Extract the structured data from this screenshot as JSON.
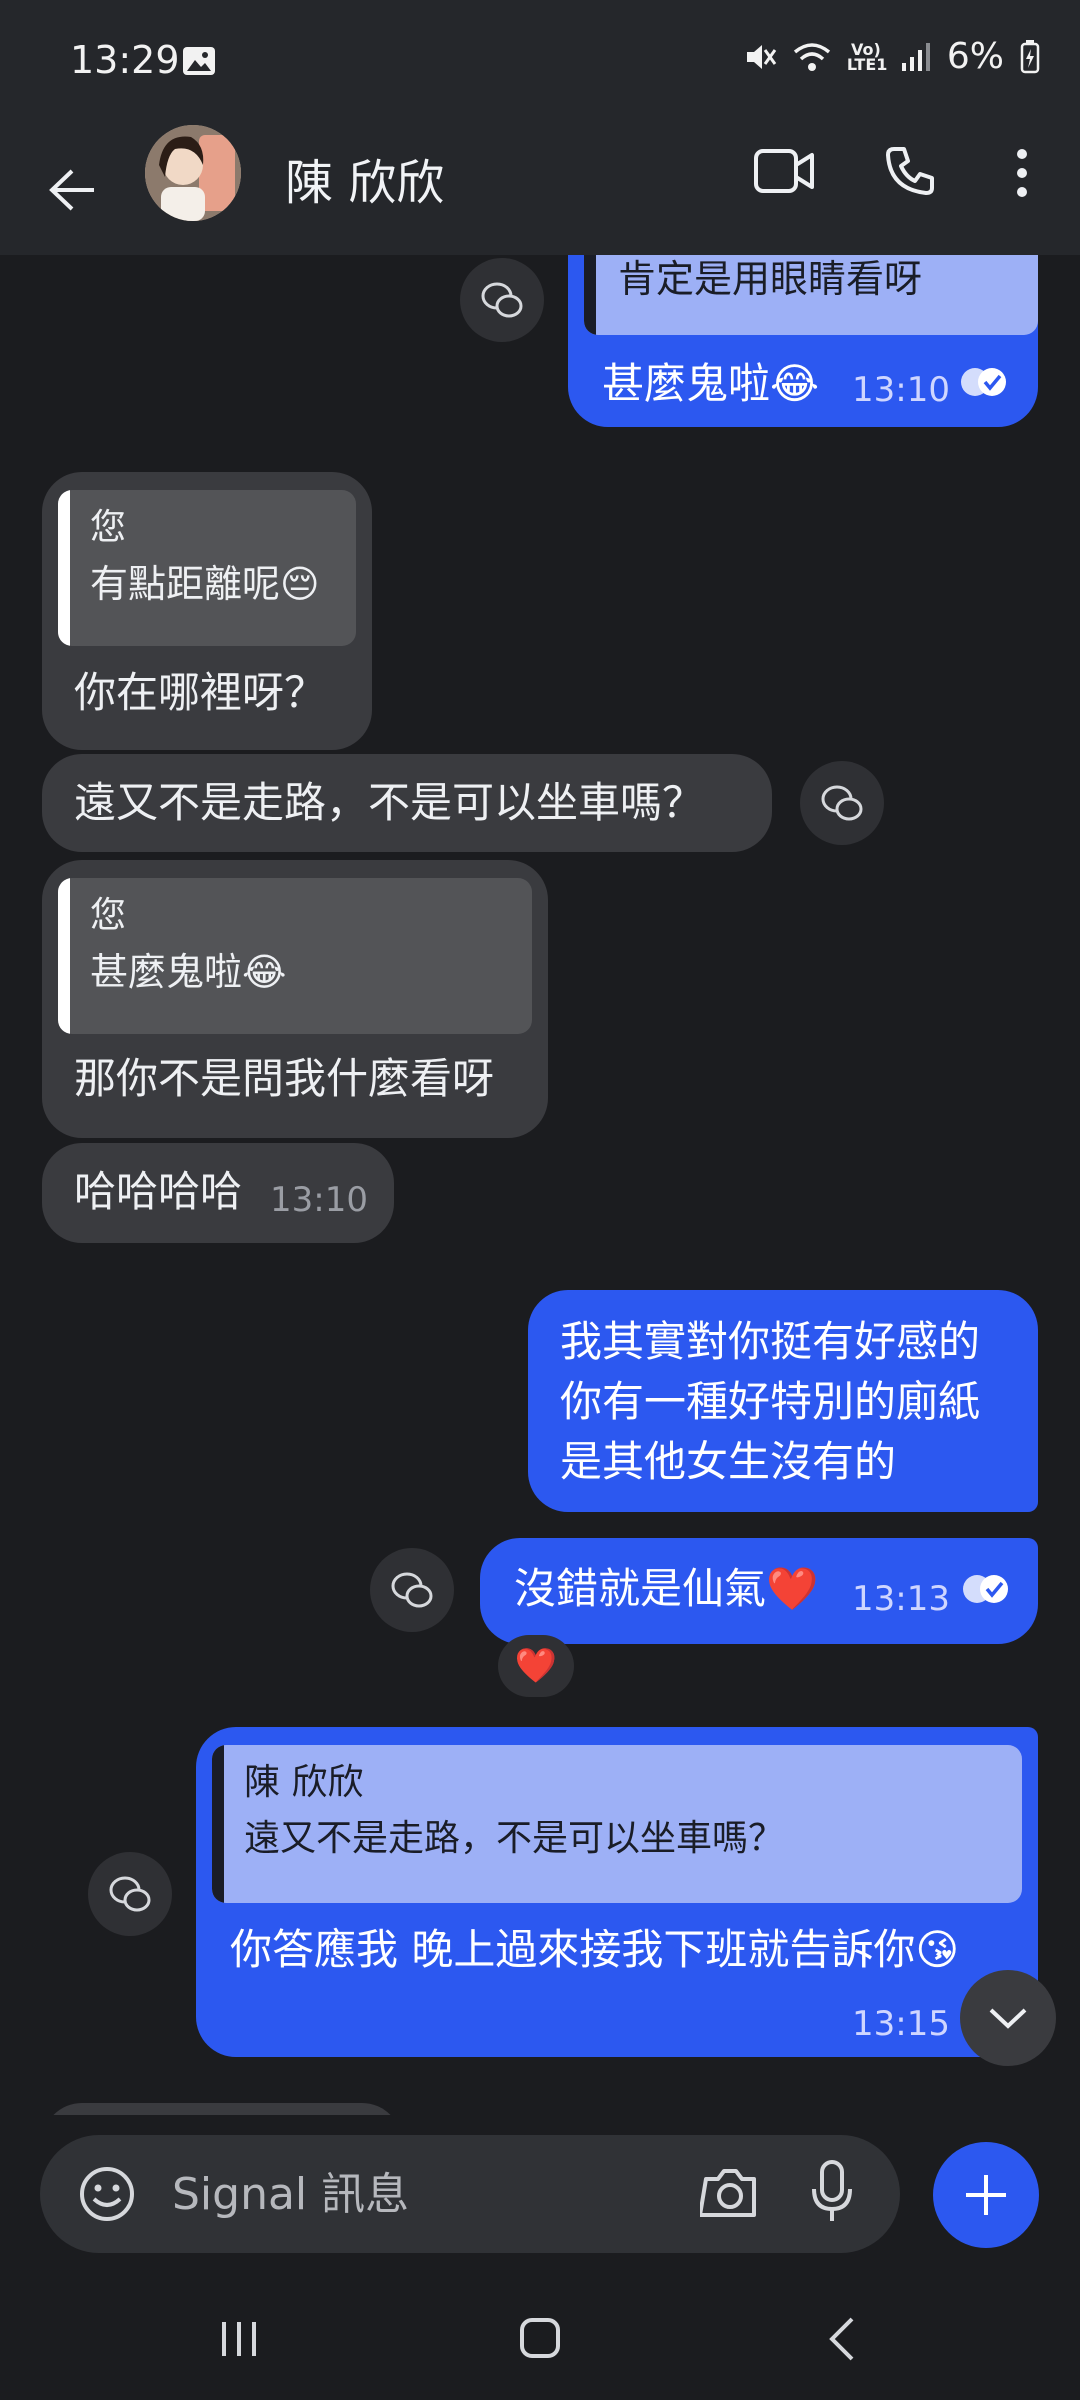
{
  "status": {
    "time": "13:29",
    "network_label": "Vo) LTE1",
    "battery": "6%"
  },
  "header": {
    "contact_name": "陳 欣欣"
  },
  "messages": {
    "m0": {
      "quote_text": "肯定是用眼睛看呀",
      "text": "甚麼鬼啦😂",
      "time": "13:10"
    },
    "m1": {
      "quote_author": "您",
      "quote_text": "有點距離呢😔",
      "text": "你在哪裡呀？"
    },
    "m2": {
      "text": "遠又不是走路，不是可以坐車嗎？"
    },
    "m3": {
      "quote_author": "您",
      "quote_text": "甚麼鬼啦😂",
      "text": "那你不是問我什麼看呀"
    },
    "m4": {
      "text": "哈哈哈哈",
      "time": "13:10"
    },
    "m5": {
      "lines": [
        "我其實對你挺有好感的",
        "你有一種好特別的廁紙",
        "是其他女生沒有的"
      ]
    },
    "m6": {
      "text": "沒錯就是仙氣❤️",
      "time": "13:13",
      "reaction": "❤️"
    },
    "m7": {
      "quote_author": "陳 欣欣",
      "quote_text": "遠又不是走路，不是可以坐車嗎？",
      "text": "你答應我 晚上過來接我下班就告訴你😘",
      "time": "13:15"
    }
  },
  "composer": {
    "placeholder": "Signal 訊息"
  },
  "colors": {
    "outgoing": "#2c58f0",
    "incoming": "#3a3b3f",
    "background": "#1b1c1f"
  }
}
